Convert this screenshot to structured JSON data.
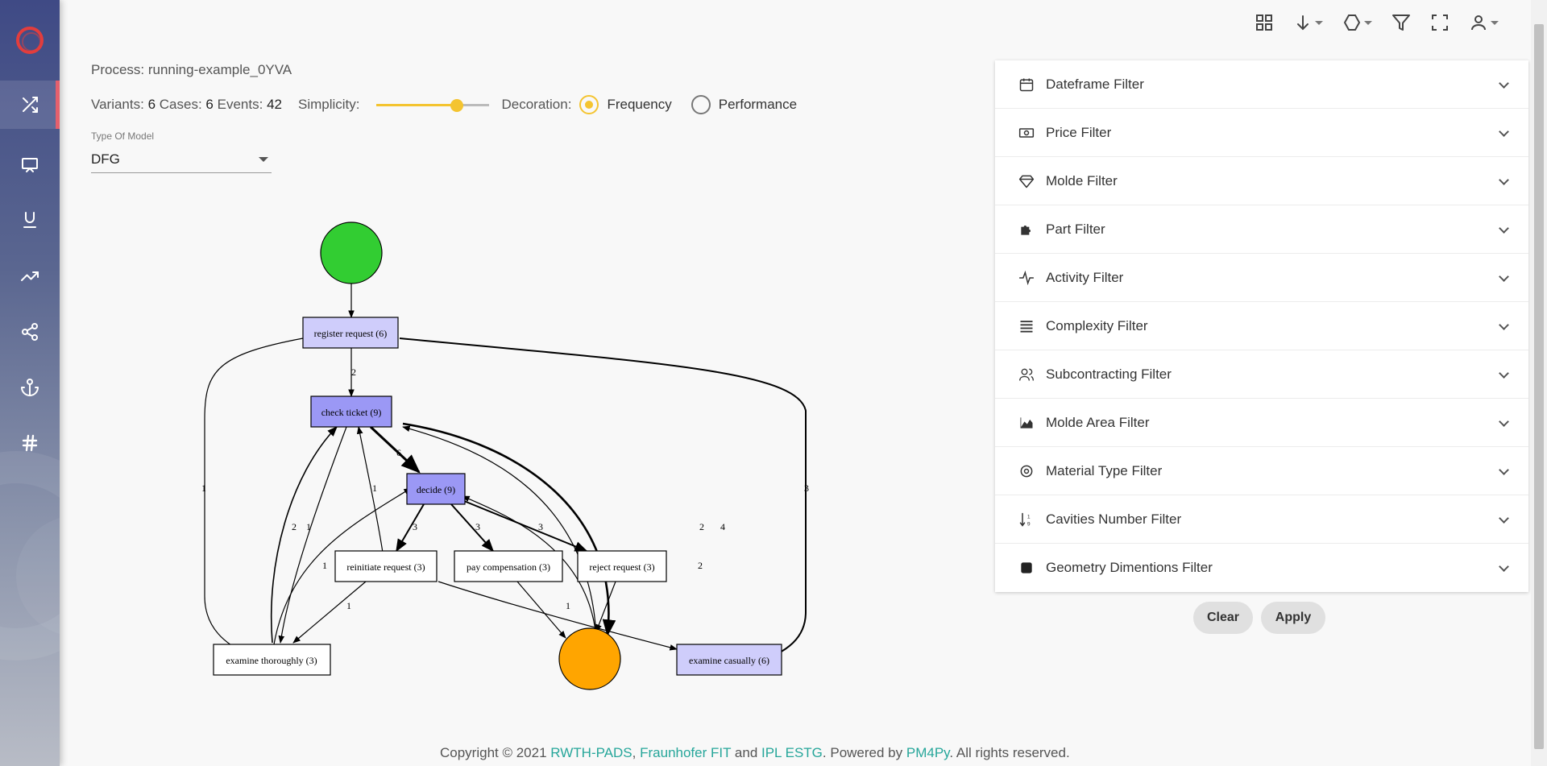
{
  "sidebar": {
    "logo": "logo-ring-icon",
    "items": [
      {
        "icon": "shuffle-icon",
        "active": true
      },
      {
        "icon": "monitor-icon",
        "active": false
      },
      {
        "icon": "underline-icon",
        "active": false
      },
      {
        "icon": "trending-up-icon",
        "active": false
      },
      {
        "icon": "share-icon",
        "active": false
      },
      {
        "icon": "anchor-icon",
        "active": false
      },
      {
        "icon": "hash-icon",
        "active": false
      }
    ]
  },
  "topbar": [
    "grid-icon",
    "download-icon",
    "hexagon-icon",
    "filter-icon",
    "fullscreen-icon",
    "user-icon"
  ],
  "header": {
    "process_label": "Process: running-example_0YVA",
    "variants_label": "Variants:",
    "variants_value": "6",
    "cases_label": "Cases:",
    "cases_value": "6",
    "events_label": "Events:",
    "events_value": "42",
    "simplicity_label": "Simplicity:",
    "simplicity_level": 0.72,
    "decoration_label": "Decoration:",
    "decoration_options": [
      "Frequency",
      "Performance"
    ],
    "decoration_selected": "Frequency"
  },
  "model": {
    "label": "Type Of Model",
    "value": "DFG"
  },
  "graph": {
    "nodes": [
      {
        "id": "start",
        "kind": "start",
        "color": "#32cd32"
      },
      {
        "id": "end",
        "kind": "end",
        "color": "#ffa500"
      },
      {
        "id": "register",
        "label": "register request (6)",
        "fill": "#cfcdfb"
      },
      {
        "id": "check",
        "label": "check ticket (9)",
        "fill": "#9b98f5"
      },
      {
        "id": "decide",
        "label": "decide (9)",
        "fill": "#9b98f5"
      },
      {
        "id": "reinitiate",
        "label": "reinitiate request (3)",
        "fill": "#ffffff"
      },
      {
        "id": "paycomp",
        "label": "pay compensation (3)",
        "fill": "#ffffff"
      },
      {
        "id": "reject",
        "label": "reject request (3)",
        "fill": "#ffffff"
      },
      {
        "id": "thorough",
        "label": "examine thoroughly (3)",
        "fill": "#ffffff"
      },
      {
        "id": "casual",
        "label": "examine casually (6)",
        "fill": "#cfcdfb"
      }
    ],
    "edge_labels": [
      "2",
      "1",
      "3",
      "6",
      "3",
      "3",
      "3",
      "2",
      "1",
      "1",
      "1",
      "1",
      "1",
      "2",
      "2",
      "4"
    ]
  },
  "filters": [
    {
      "label": "Dateframe Filter",
      "icon": "calendar-icon"
    },
    {
      "label": "Price Filter",
      "icon": "money-icon"
    },
    {
      "label": "Molde Filter",
      "icon": "diamond-icon"
    },
    {
      "label": "Part Filter",
      "icon": "puzzle-icon"
    },
    {
      "label": "Activity Filter",
      "icon": "activity-icon"
    },
    {
      "label": "Complexity Filter",
      "icon": "list-icon"
    },
    {
      "label": "Subcontracting Filter",
      "icon": "people-icon"
    },
    {
      "label": "Molde Area Filter",
      "icon": "area-chart-icon"
    },
    {
      "label": "Material Type Filter",
      "icon": "target-icon"
    },
    {
      "label": "Cavities Number Filter",
      "icon": "sort-numeric-icon"
    },
    {
      "label": "Geometry Dimentions Filter",
      "icon": "square-icon"
    }
  ],
  "buttons": {
    "clear": "Clear",
    "apply": "Apply"
  },
  "footer": {
    "prefix": "Copyright © 2021 ",
    "link1": "RWTH-PADS",
    "sep1": ", ",
    "link2": "Fraunhofer FIT",
    "sep2": " and ",
    "link3": "IPL ESTG",
    "sep3": ". Powered by ",
    "link4": "PM4Py",
    "suffix": ". All rights reserved."
  },
  "colors": {
    "accent": "#f4c430",
    "link": "#26a69a",
    "sidebar_active": "#e4606d"
  }
}
